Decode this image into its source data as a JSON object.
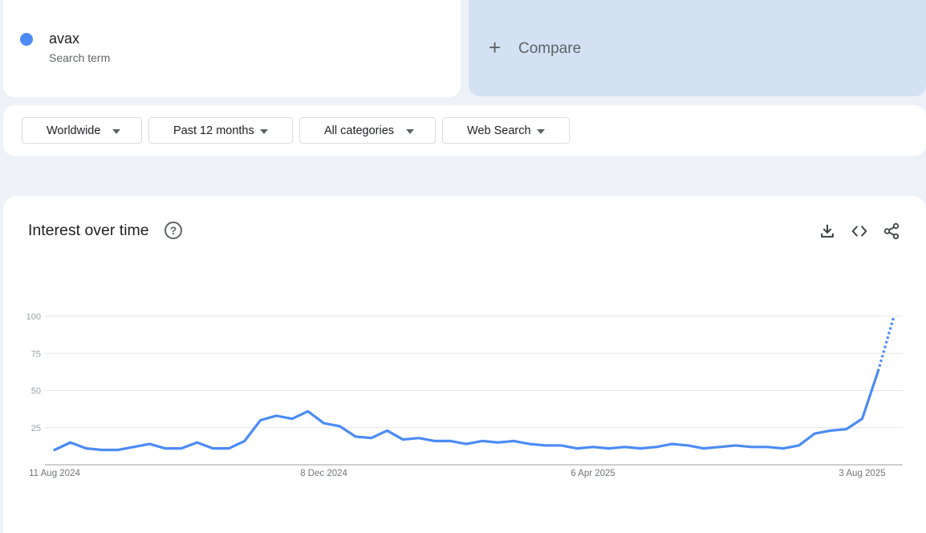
{
  "term": {
    "name": "avax",
    "subtitle": "Search term",
    "color": "#4c8bf5"
  },
  "compare": {
    "icon": "plus-icon",
    "plus": "+",
    "label": "Compare"
  },
  "filters": {
    "region": "Worldwide",
    "period": "Past 12 months",
    "category": "All categories",
    "search_type": "Web Search"
  },
  "panel": {
    "title": "Interest over time",
    "help_icon": "question-mark-circle-icon",
    "help_glyph": "?",
    "tools": [
      "download-icon",
      "embed-code-icon",
      "share-icon"
    ]
  },
  "chart_data": {
    "type": "line",
    "title": "Interest over time",
    "xlabel": "",
    "ylabel": "",
    "ylim": [
      0,
      100
    ],
    "yticks": [
      25,
      50,
      75,
      100
    ],
    "grid": true,
    "x_tick_labels": [
      {
        "index": 0,
        "label": "11 Aug 2024"
      },
      {
        "index": 17,
        "label": "8 Dec 2024"
      },
      {
        "index": 34,
        "label": "6 Apr 2025"
      },
      {
        "index": 51,
        "label": "3 Aug 2025"
      }
    ],
    "series": [
      {
        "name": "avax",
        "color": "#4c8bf5",
        "partial_last_point": true,
        "values": [
          10,
          15,
          11,
          10,
          10,
          12,
          14,
          11,
          11,
          15,
          11,
          11,
          16,
          30,
          33,
          31,
          36,
          28,
          26,
          19,
          18,
          23,
          17,
          18,
          16,
          16,
          14,
          16,
          15,
          16,
          14,
          13,
          13,
          11,
          12,
          11,
          12,
          11,
          12,
          14,
          13,
          11,
          12,
          13,
          12,
          12,
          11,
          13,
          21,
          23,
          24,
          31,
          63,
          100
        ]
      }
    ]
  }
}
